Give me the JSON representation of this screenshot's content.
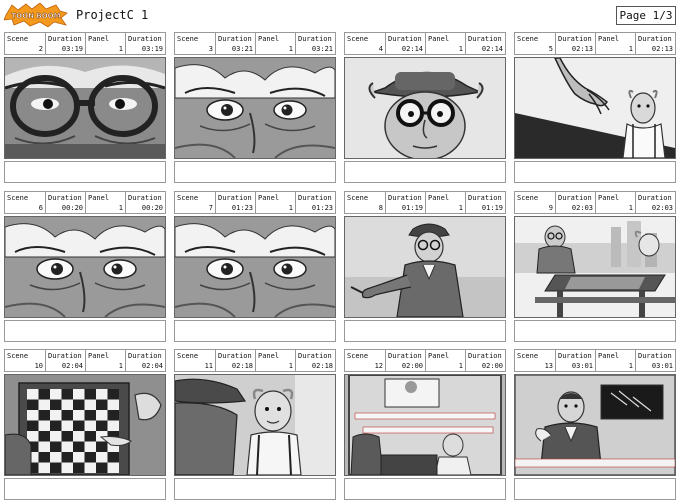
{
  "header": {
    "logo_text": "TOON BOOM",
    "project_title": "ProjectC 1",
    "page_label": "Page 1/3"
  },
  "labels": {
    "scene": "Scene",
    "duration": "Duration",
    "panel": "Panel"
  },
  "panels": [
    {
      "scene": "2",
      "scene_duration": "03:19",
      "panel": "1",
      "panel_duration": "03:19",
      "art": "eyes-glasses-closeup"
    },
    {
      "scene": "3",
      "scene_duration": "03:21",
      "panel": "1",
      "panel_duration": "03:21",
      "art": "old-man-eyes"
    },
    {
      "scene": "4",
      "scene_duration": "02:14",
      "panel": "1",
      "panel_duration": "02:14",
      "art": "man-hat-glasses"
    },
    {
      "scene": "5",
      "scene_duration": "02:13",
      "panel": "1",
      "panel_duration": "02:13",
      "art": "hand-old-man"
    },
    {
      "scene": "6",
      "scene_duration": "00:20",
      "panel": "1",
      "panel_duration": "00:20",
      "art": "old-man-eyes"
    },
    {
      "scene": "7",
      "scene_duration": "01:23",
      "panel": "1",
      "panel_duration": "01:23",
      "art": "old-man-eyes"
    },
    {
      "scene": "8",
      "scene_duration": "01:19",
      "panel": "1",
      "panel_duration": "01:19",
      "art": "man-pointing"
    },
    {
      "scene": "9",
      "scene_duration": "02:03",
      "panel": "1",
      "panel_duration": "02:03",
      "art": "park-chess"
    },
    {
      "scene": "10",
      "scene_duration": "02:04",
      "panel": "1",
      "panel_duration": "02:04",
      "art": "chessboard-topdown"
    },
    {
      "scene": "11",
      "scene_duration": "02:18",
      "panel": "1",
      "panel_duration": "02:18",
      "art": "hat-old-man"
    },
    {
      "scene": "12",
      "scene_duration": "02:00",
      "panel": "1",
      "panel_duration": "02:00",
      "art": "tv-emergency"
    },
    {
      "scene": "13",
      "scene_duration": "03:01",
      "panel": "1",
      "panel_duration": "03:01",
      "art": "newscaster"
    }
  ]
}
